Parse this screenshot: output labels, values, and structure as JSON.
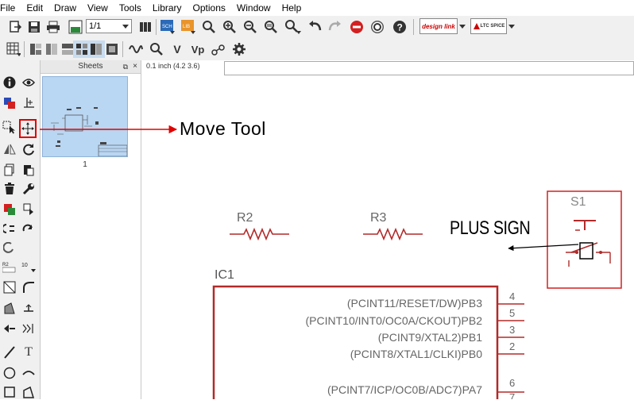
{
  "menu": [
    "File",
    "Edit",
    "Draw",
    "View",
    "Tools",
    "Library",
    "Options",
    "Window",
    "Help"
  ],
  "toolbar": {
    "sheet_value": "1/1",
    "design_link_label": "design link",
    "ltspice_label": "LTC SPICE"
  },
  "toolbar2": {
    "icon_v": "V",
    "icon_vp": "Vp"
  },
  "sheets_panel": {
    "title": "Sheets",
    "pin": "⧉",
    "close": "×",
    "sheet_number": "1"
  },
  "canvas": {
    "coord": "0.1 inch (4.2 3.6)",
    "r2_label": "R2",
    "r3_label": "R3",
    "s1_label": "S1",
    "ic1_label": "IC1",
    "ic_pins": [
      {
        "label": "(PCINT11/RESET/DW)PB3",
        "number": "4"
      },
      {
        "label": "(PCINT10/INT0/OC0A/CKOUT)PB2",
        "number": "5"
      },
      {
        "label": "(PCINT9/XTAL2)PB1",
        "number": "3"
      },
      {
        "label": "(PCINT8/XTAL1/CLKI)PB0",
        "number": "2"
      },
      {
        "label": "(PCINT7/ICP/OC0B/ADC7)PA7",
        "number": "6"
      }
    ],
    "ic_pin_partial": "7"
  },
  "annotations": {
    "move_tool": "Move Tool",
    "plus_sign": "PLUS SIGN"
  },
  "colors": {
    "schematic_red": "#b22a2a",
    "annotation_red": "#e00000",
    "thumb_blue": "#b9d6f2"
  }
}
